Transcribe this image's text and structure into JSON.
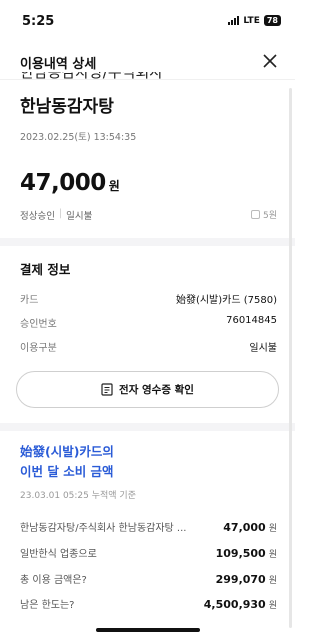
{
  "status_bar": {
    "time": "5:25",
    "network": "LTE",
    "battery": "78"
  },
  "header": {
    "title": "이용내역 상세"
  },
  "transaction": {
    "clipped_title": "한남동감자탕/주식회사",
    "merchant": "한남동감자탕",
    "datetime": "2023.02.25(토) 13:54:35",
    "amount": "47,000",
    "amount_unit": "원",
    "approval_status": "정상승인",
    "separator": "|",
    "payment_type": "일시불",
    "points": "5원"
  },
  "payment_info": {
    "title": "결제 정보",
    "rows": [
      {
        "label": "카드",
        "value": "始發(시발)카드 (7580)"
      },
      {
        "label": "승인번호",
        "value": "76014845"
      },
      {
        "label": "이용구분",
        "value": "일시불"
      }
    ],
    "receipt_button": "전자 영수증 확인"
  },
  "monthly": {
    "title_line1": "始發(시발)카드의",
    "title_line2": "이번 달 소비 금액",
    "as_of": "23.03.01 05:25 누적액 기준",
    "rows": [
      {
        "label": "한남동감자탕/주식회사 한남동감자탕 ...",
        "value": "47,000",
        "unit": "원"
      },
      {
        "label": "일반한식 업종으로",
        "value": "109,500",
        "unit": "원"
      },
      {
        "label": "총 이용 금액은?",
        "value": "299,070",
        "unit": "원"
      },
      {
        "label": "남은 한도는?",
        "value": "4,500,930",
        "unit": "원"
      }
    ]
  },
  "colors": {
    "accent": "#2a5bd7",
    "band": "#f4f4f6"
  }
}
